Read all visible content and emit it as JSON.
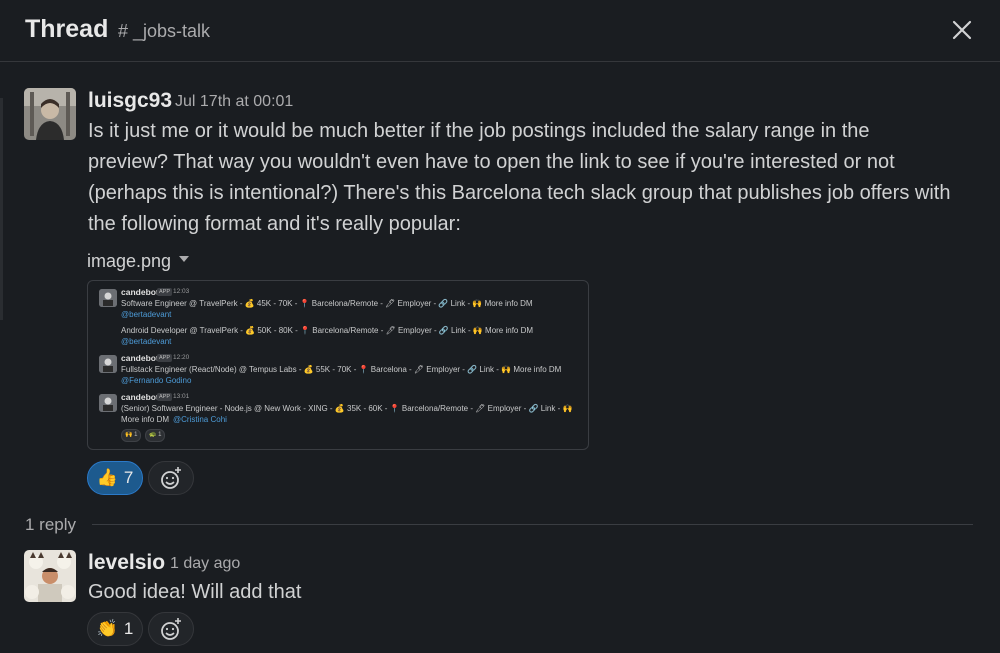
{
  "header": {
    "title": "Thread",
    "channel": "# _jobs-talk"
  },
  "icons": {
    "close": "close-icon",
    "caret": "caret-down-icon",
    "add_reaction": "add-reaction-icon"
  },
  "message": {
    "author": "luisgc93",
    "timestamp": "Jul 17th at 00:01",
    "lines": [
      "Is it just me or it would be much better if the job postings included the salary range in the",
      "preview? That way you wouldn't even have to open the link to see if you're interested or not",
      "(perhaps this is intentional?) There's this Barcelona tech slack group that publishes job offers with",
      "the following format and it's really popular:"
    ],
    "attachment": {
      "filename": "image.png",
      "posts": [
        {
          "name": "candebot",
          "app": "APP",
          "time": "12:03",
          "lines": [
            "Software Engineer @ TravelPerk - 💰 45K - 70K - 📍 Barcelona/Remote - 🖊 Employer - 🔗 Link - 🙌 More info DM"
          ],
          "mention": "@bertadevant"
        },
        {
          "name": "",
          "app": "",
          "time": "",
          "lines": [
            "Android Developer @ TravelPerk - 💰 50K - 80K - 📍 Barcelona/Remote - 🖊 Employer - 🔗 Link - 🙌 More info DM"
          ],
          "mention": "@bertadevant"
        },
        {
          "name": "candebot",
          "app": "APP",
          "time": "12:20",
          "lines": [
            "Fullstack Engineer (React/Node) @ Tempus Labs - 💰 55K - 70K - 📍 Barcelona - 🖊 Employer - 🔗 Link - 🙌 More info DM"
          ],
          "mention": "@Fernando Godino"
        },
        {
          "name": "candebot",
          "app": "APP",
          "time": "13:01",
          "lines": [
            "(Senior) Software Engineer - Node.js @ New Work - XING - 💰 35K - 60K - 📍 Barcelona/Remote - 🖊 Employer - 🔗 Link - 🙌",
            "More info DM"
          ],
          "mention": "@Cristina Cohi",
          "reactions": [
            "🙌 1",
            "🐢 1"
          ]
        }
      ]
    },
    "reaction": {
      "emoji": "👍",
      "count": "7"
    }
  },
  "reply_count": "1 reply",
  "reply": {
    "author": "levelsio",
    "timestamp": "1 day ago",
    "text": "Good idea! Will add that",
    "reaction": {
      "emoji": "👏",
      "count": "1"
    }
  }
}
